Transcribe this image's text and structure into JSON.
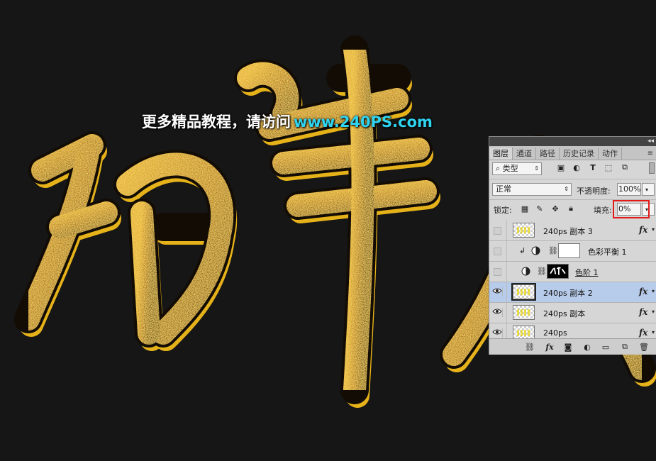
{
  "watermark": {
    "text": "更多精品教程，请访问",
    "url": "www.240PS.com"
  },
  "layers_panel": {
    "tabs": [
      {
        "label": "图层",
        "active": true
      },
      {
        "label": "通道",
        "active": false
      },
      {
        "label": "路径",
        "active": false
      },
      {
        "label": "历史记录",
        "active": false
      },
      {
        "label": "动作",
        "active": false
      }
    ],
    "filter": {
      "kind_label": "类型"
    },
    "blend_mode": "正常",
    "opacity_label": "不透明度:",
    "opacity_value": "100%",
    "lock_label": "锁定:",
    "fill_label": "填充:",
    "fill_value": "0%",
    "layers": [
      {
        "name": "240ps 副本 3",
        "visible": false,
        "selected": false,
        "thumb": "checker",
        "fx": "fx"
      },
      {
        "name": "色彩平衡 1",
        "visible": false,
        "selected": false,
        "thumb": "white",
        "adjustment": "color-balance"
      },
      {
        "name": "色阶 1",
        "visible": false,
        "selected": false,
        "thumb": "black",
        "adjustment": "levels"
      },
      {
        "name": "240ps 副本 2",
        "visible": true,
        "selected": true,
        "thumb": "checker",
        "fx": "fx"
      },
      {
        "name": "240ps 副本",
        "visible": true,
        "selected": false,
        "thumb": "checker",
        "fx": "fx"
      },
      {
        "name": "240ps",
        "visible": true,
        "selected": false,
        "thumb": "checker",
        "fx": "fx"
      }
    ],
    "bottom_fx": "fx"
  },
  "colors": {
    "background": "#161616",
    "gold_light": "#f2c94c",
    "gold_dark": "#7a4a05",
    "watermark_url": "#2fd4f0",
    "panel_bg": "#d6d6d6",
    "selected_layer": "#b7cbea",
    "highlight": "#e21a1a"
  }
}
